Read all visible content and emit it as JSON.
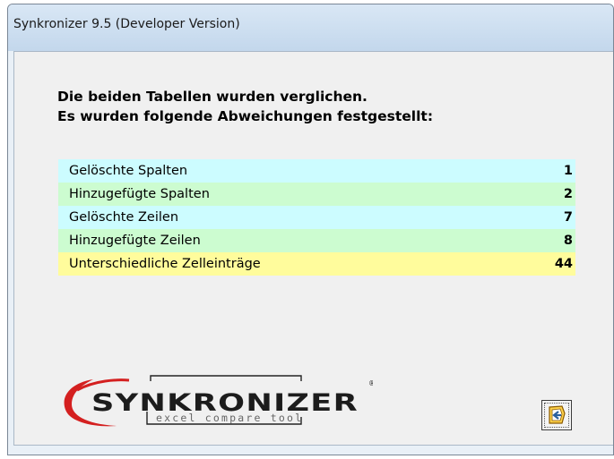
{
  "window": {
    "title": "Synkronizer 9.5 (Developer Version)"
  },
  "message": {
    "line1": "Die beiden Tabellen wurden verglichen.",
    "line2": "Es wurden folgende Abweichungen festgestellt:"
  },
  "results": [
    {
      "label": "Gelöschte Spalten",
      "count": "1",
      "color": "#ccfcff"
    },
    {
      "label": "Hinzugefügte Spalten",
      "count": "2",
      "color": "#ccfcd0"
    },
    {
      "label": "Gelöschte Zeilen",
      "count": "7",
      "color": "#ccfcff"
    },
    {
      "label": "Hinzugefügte Zeilen",
      "count": "8",
      "color": "#ccfcd0"
    },
    {
      "label": "Unterschiedliche Zelleinträge",
      "count": "44",
      "color": "#fffc9c"
    }
  ],
  "logo": {
    "name": "SYNKRONIZER",
    "tagline": "excel compare tool",
    "accent_color": "#d42020"
  },
  "ok_button": {
    "icon": "exit-door-icon"
  }
}
